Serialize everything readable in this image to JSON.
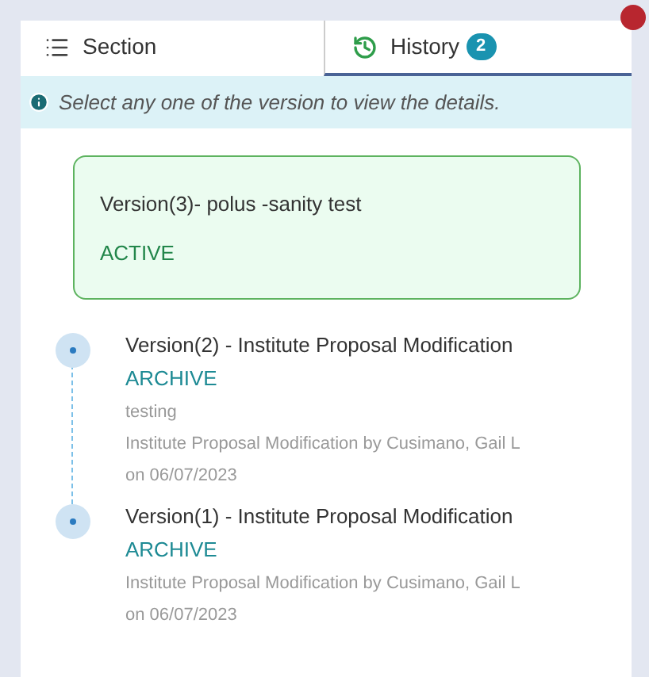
{
  "tabs": [
    {
      "label": "Section",
      "selected": false
    },
    {
      "label": "History",
      "badge": "2",
      "selected": true
    }
  ],
  "info": "Select any one of the version to view the details.",
  "current": {
    "title": "Version(3)- polus -sanity test",
    "status": "ACTIVE"
  },
  "versions": [
    {
      "title": "Version(2) - Institute Proposal Modification",
      "status": "ARCHIVE",
      "comment": "testing",
      "detail": "Institute Proposal Modification by Cusimano, Gail L on 06/07/2023"
    },
    {
      "title": "Version(1) - Institute Proposal Modification",
      "status": "ARCHIVE",
      "detail": "Institute Proposal Modification by Cusimano, Gail L on 06/07/2023"
    }
  ]
}
